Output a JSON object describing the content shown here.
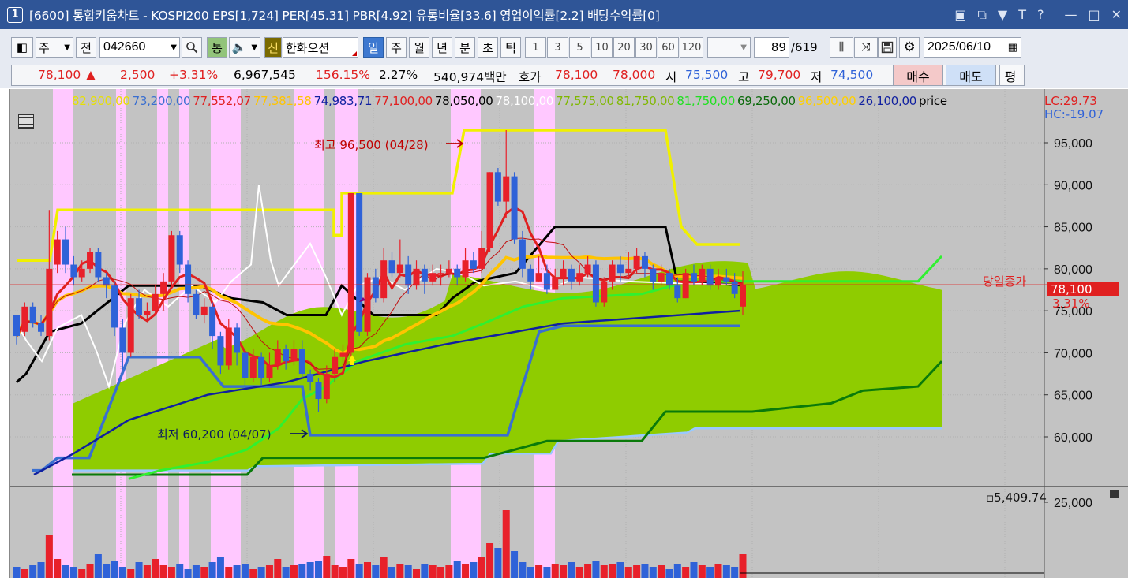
{
  "window": {
    "number": "1",
    "title": "[6600] 통합키움차트 - KOSPI200 EPS[1,724] PER[45.31] PBR[4.92] 유통비율[33.6] 영업이익률[2.2] 배당수익률[0]",
    "icons": [
      "window-restore-icon",
      "copy-icon",
      "pin-icon",
      "font-icon",
      "help-icon",
      "minimize-icon",
      "maximize-icon",
      "close-icon"
    ]
  },
  "toolbar": {
    "period_select": "주",
    "prev_label": "전",
    "code": "042660",
    "tong_label": "통",
    "shin_label": "신",
    "stock_name": "한화오션",
    "periods": [
      "일",
      "주",
      "월",
      "년",
      "분",
      "초",
      "틱"
    ],
    "active_period": "일",
    "intervals": [
      "1",
      "3",
      "5",
      "10",
      "20",
      "30",
      "60",
      "120"
    ],
    "count": "89",
    "total": "/619",
    "date": "2025/06/10"
  },
  "quote": {
    "price": "78,100",
    "change_arrow": "▲",
    "change": "2,500",
    "change_pct": "+3.31%",
    "volume": "6,967,545",
    "volume_ratio": "156.15%",
    "turnover": "2.27%",
    "amount": "540,974백만",
    "ask_label": "호가",
    "ask": "78,100",
    "bid": "78,000",
    "open_label": "시",
    "open": "75,500",
    "high_label": "고",
    "high": "79,700",
    "low_label": "저",
    "low": "74,500",
    "buy_label": "매수",
    "sell_label": "매도",
    "eval_label": "평"
  },
  "legend": [
    {
      "text": "82,900,00",
      "color": "#e8e000"
    },
    {
      "text": "73,200,00",
      "color": "#3a6fd0"
    },
    {
      "text": "77,552,07",
      "color": "#e02020"
    },
    {
      "text": "77,381,58",
      "color": "#ffc400"
    },
    {
      "text": "74,983,71",
      "color": "#1020a0"
    },
    {
      "text": "77,100,00",
      "color": "#e02020"
    },
    {
      "text": "78,050,00",
      "color": "#000000"
    },
    {
      "text": "78,100,00",
      "color": "#ffffff"
    },
    {
      "text": "77,575,00",
      "color": "#7fb800"
    },
    {
      "text": "81,750,00",
      "color": "#7fb800"
    },
    {
      "text": "81,750,00",
      "color": "#20e020"
    },
    {
      "text": "69,250,00",
      "color": "#0a6a0a"
    },
    {
      "text": "96,500,00",
      "color": "#ffd000"
    },
    {
      "text": "26,100,00",
      "color": "#1020a0"
    },
    {
      "text": "price",
      "color": "#000000"
    }
  ],
  "annotations": {
    "high_label": "최고 96,500 (04/28)",
    "low_label": "최저 60,200 (04/07)",
    "close_label": "당일종가",
    "close_value": "78,100",
    "close_pct": "3.31%",
    "lc": "LC:29.73",
    "hc": "HC:-19.07",
    "volume_value": "5,409.74"
  },
  "colors": {
    "up": "#e8202a",
    "down": "#2f62d8",
    "highlight": "#ffc8ff",
    "cloud": "#8fcc00",
    "background": "#c3c3c3"
  },
  "chart_data": {
    "type": "candlestick",
    "yticks": [
      "95,000",
      "90,000",
      "85,000",
      "80,000",
      "75,000",
      "70,000",
      "65,000",
      "60,000"
    ],
    "ylim": [
      55000,
      97000
    ],
    "volume_ticks": [
      "25,000"
    ],
    "ohlc": [
      [
        74500,
        72000,
        74500,
        71000
      ],
      [
        72500,
        75500,
        76000,
        72000
      ],
      [
        75500,
        73500,
        76000,
        73000
      ],
      [
        73500,
        72500,
        74500,
        72000
      ],
      [
        72000,
        80000,
        87000,
        71500
      ],
      [
        80500,
        83500,
        84500,
        79500
      ],
      [
        83500,
        80500,
        85000,
        79500
      ],
      [
        80500,
        79000,
        81500,
        78000
      ],
      [
        79000,
        80000,
        81000,
        78500
      ],
      [
        80000,
        82000,
        82500,
        79500
      ],
      [
        82000,
        79000,
        82500,
        78500
      ],
      [
        79000,
        78000,
        79500,
        76500
      ],
      [
        78000,
        73000,
        78500,
        72000
      ],
      [
        73000,
        70000,
        74000,
        68000
      ],
      [
        70000,
        76500,
        77000,
        69500
      ],
      [
        76500,
        74500,
        77500,
        74000
      ],
      [
        74500,
        75000,
        76000,
        74000
      ],
      [
        75000,
        77000,
        78000,
        74500
      ],
      [
        77000,
        78500,
        79500,
        75000
      ],
      [
        78500,
        84000,
        84500,
        78000
      ],
      [
        84000,
        80500,
        84500,
        79500
      ],
      [
        80500,
        77000,
        81000,
        76000
      ],
      [
        77000,
        74500,
        77500,
        74000
      ],
      [
        74500,
        75500,
        76500,
        73500
      ],
      [
        75500,
        72000,
        76000,
        70500
      ],
      [
        72000,
        68500,
        72500,
        67500
      ],
      [
        68500,
        73000,
        74000,
        68000
      ],
      [
        73000,
        70000,
        73500,
        68500
      ],
      [
        70000,
        67000,
        70500,
        66000
      ],
      [
        67000,
        69500,
        70500,
        66500
      ],
      [
        69500,
        67000,
        70000,
        66000
      ],
      [
        67000,
        68500,
        70000,
        66500
      ],
      [
        68500,
        70500,
        71500,
        68000
      ],
      [
        70500,
        69000,
        71000,
        68000
      ],
      [
        69000,
        70500,
        71500,
        68500
      ],
      [
        70500,
        67500,
        71500,
        67000
      ],
      [
        67500,
        66500,
        68000,
        65500
      ],
      [
        66500,
        64500,
        67000,
        63000
      ],
      [
        64500,
        67500,
        68500,
        64000
      ],
      [
        67500,
        69500,
        70500,
        66500
      ],
      [
        69500,
        70000,
        71000,
        68500
      ],
      [
        70000,
        89000,
        89000,
        69500
      ],
      [
        89000,
        72500,
        89000,
        72000
      ],
      [
        72500,
        79000,
        79500,
        72000
      ],
      [
        79000,
        76500,
        80000,
        76000
      ],
      [
        76500,
        81000,
        82500,
        76000
      ],
      [
        81000,
        79500,
        82000,
        79000
      ],
      [
        79500,
        80500,
        83500,
        79000
      ],
      [
        80500,
        78000,
        81500,
        77000
      ],
      [
        78000,
        80000,
        81000,
        77500
      ],
      [
        80000,
        78500,
        80500,
        77000
      ],
      [
        78500,
        79500,
        80500,
        78000
      ],
      [
        79500,
        79500,
        80500,
        78000
      ],
      [
        79500,
        80000,
        81000,
        79000
      ],
      [
        80000,
        79000,
        80500,
        78000
      ],
      [
        79000,
        81000,
        82500,
        78500
      ],
      [
        81000,
        80000,
        82000,
        79500
      ],
      [
        80000,
        82500,
        84500,
        79500
      ],
      [
        82500,
        91500,
        91500,
        82000
      ],
      [
        91500,
        88000,
        92000,
        87500
      ],
      [
        88000,
        91000,
        96500,
        86000
      ],
      [
        91000,
        83500,
        91500,
        83000
      ],
      [
        83500,
        80000,
        84500,
        79000
      ],
      [
        80000,
        78500,
        80500,
        77500
      ],
      [
        78500,
        79500,
        81500,
        78500
      ],
      [
        79500,
        77500,
        80500,
        77000
      ],
      [
        77500,
        79000,
        80000,
        77500
      ],
      [
        79000,
        80000,
        81000,
        78000
      ],
      [
        80000,
        78500,
        80500,
        77500
      ],
      [
        78500,
        79500,
        80500,
        78000
      ],
      [
        79500,
        80500,
        81500,
        79000
      ],
      [
        80500,
        76000,
        81000,
        75500
      ],
      [
        76000,
        78500,
        79000,
        75500
      ],
      [
        78500,
        80500,
        81000,
        77500
      ],
      [
        80500,
        79500,
        81500,
        78500
      ],
      [
        79500,
        80000,
        82000,
        79000
      ],
      [
        80000,
        81500,
        82500,
        79500
      ],
      [
        81500,
        80000,
        82000,
        79000
      ],
      [
        80000,
        78500,
        80500,
        77500
      ],
      [
        78500,
        79500,
        80500,
        78000
      ],
      [
        79500,
        78000,
        80000,
        77500
      ],
      [
        78000,
        76500,
        79000,
        76000
      ],
      [
        76500,
        79500,
        80000,
        76500
      ],
      [
        79500,
        78500,
        80500,
        78000
      ],
      [
        78500,
        80000,
        80500,
        78000
      ],
      [
        80000,
        78000,
        80500,
        77500
      ],
      [
        78000,
        79000,
        80000,
        77500
      ],
      [
        79000,
        78500,
        80000,
        78000
      ],
      [
        78500,
        77000,
        79500,
        76500
      ],
      [
        75500,
        78100,
        79700,
        74500
      ]
    ]
  }
}
